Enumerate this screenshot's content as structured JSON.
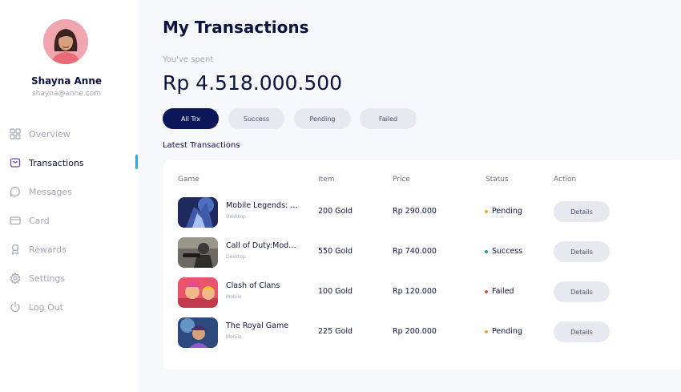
{
  "profile": {
    "name": "Shayna Anne",
    "email": "shayna@anne.com"
  },
  "nav": [
    {
      "label": "Overview",
      "icon": "overview-icon"
    },
    {
      "label": "Transactions",
      "icon": "transactions-icon",
      "active": true
    },
    {
      "label": "Messages",
      "icon": "messages-icon"
    },
    {
      "label": "Card",
      "icon": "card-icon"
    },
    {
      "label": "Rewards",
      "icon": "rewards-icon"
    },
    {
      "label": "Settings",
      "icon": "settings-icon"
    },
    {
      "label": "Log Out",
      "icon": "logout-icon"
    }
  ],
  "page": {
    "title": "My Transactions",
    "spent_label": "You've spent",
    "spent_amount": "Rp 4.518.000.500"
  },
  "filters": [
    {
      "label": "All Trx",
      "active": true
    },
    {
      "label": "Success"
    },
    {
      "label": "Pending"
    },
    {
      "label": "Failed"
    }
  ],
  "table": {
    "title": "Latest Transactions",
    "headers": [
      "Game",
      "Item",
      "Price",
      "Status",
      "Action"
    ],
    "rows": [
      {
        "game": "Mobile Legends: Bang Bang",
        "platform": "Desktop",
        "item": "200 Gold",
        "price": "Rp 290.000",
        "status": "Pending",
        "action": "Details"
      },
      {
        "game": "Call of Duty:Modern Warfare",
        "platform": "Desktop",
        "item": "550 Gold",
        "price": "Rp 740.000",
        "status": "Success",
        "action": "Details"
      },
      {
        "game": "Clash of Clans",
        "platform": "Mobile",
        "item": "100 Gold",
        "price": "Rp 120.000",
        "status": "Failed",
        "action": "Details"
      },
      {
        "game": "The Royal Game",
        "platform": "Mobile",
        "item": "225 Gold",
        "price": "Rp 200.000",
        "status": "Pending",
        "action": "Details"
      }
    ]
  },
  "colors": {
    "primary": "#0B1659",
    "accent": "#2FA6F0",
    "pending": "#F5A623",
    "success": "#1FAA73",
    "failed": "#E8473F"
  }
}
